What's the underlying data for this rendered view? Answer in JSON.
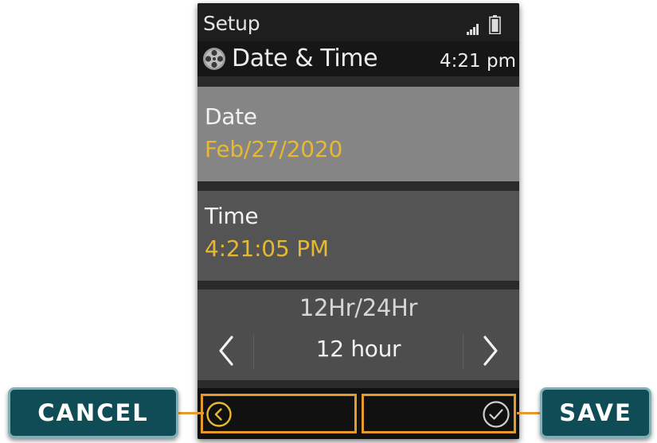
{
  "status_bar": {
    "app_name": "Setup",
    "signal_icon": "signal-bars-icon",
    "battery_icon": "battery-icon"
  },
  "title_bar": {
    "icon": "film-reel-icon",
    "title": "Date & Time",
    "clock": "4:21 pm"
  },
  "items": {
    "date": {
      "label": "Date",
      "value": "Feb/27/2020"
    },
    "time": {
      "label": "Time",
      "value": "4:21:05 PM"
    }
  },
  "format_selector": {
    "title": "12Hr/24Hr",
    "value": "12 hour",
    "prev_icon": "chevron-left-icon",
    "next_icon": "chevron-right-icon"
  },
  "softkeys": {
    "left_icon": "back-circle-icon",
    "right_icon": "check-circle-icon"
  },
  "callouts": {
    "cancel": "CANCEL",
    "save": "SAVE"
  },
  "colors": {
    "highlight_value": "#e8b830",
    "softkey_outline": "#e49a2c",
    "callout_background": "#0f4c55",
    "selected_item": "#858585"
  }
}
